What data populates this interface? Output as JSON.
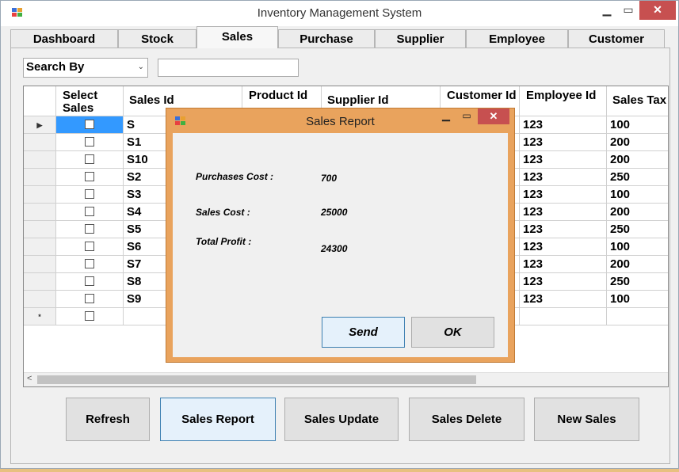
{
  "window": {
    "title": "Inventory Management System"
  },
  "tabs": [
    "Dashboard",
    "Stock",
    "Sales",
    "Purchase",
    "Supplier",
    "Employee",
    "Customer"
  ],
  "active_tab": "Sales",
  "search": {
    "selected": "Search By",
    "value": ""
  },
  "grid": {
    "headers": [
      "Select Sales",
      "Sales Id",
      "Product Id",
      "Supplier Id",
      "Customer Id",
      "Employee Id",
      "Sales Tax"
    ],
    "rows": [
      {
        "sales_id": "S",
        "employee_id": "123",
        "sales_tax": "100"
      },
      {
        "sales_id": "S1",
        "employee_id": "123",
        "sales_tax": "200"
      },
      {
        "sales_id": "S10",
        "employee_id": "123",
        "sales_tax": "200"
      },
      {
        "sales_id": "S2",
        "employee_id": "123",
        "sales_tax": "250"
      },
      {
        "sales_id": "S3",
        "employee_id": "123",
        "sales_tax": "100"
      },
      {
        "sales_id": "S4",
        "employee_id": "123",
        "sales_tax": "200"
      },
      {
        "sales_id": "S5",
        "employee_id": "123",
        "sales_tax": "250"
      },
      {
        "sales_id": "S6",
        "employee_id": "123",
        "sales_tax": "100"
      },
      {
        "sales_id": "S7",
        "employee_id": "123",
        "sales_tax": "200"
      },
      {
        "sales_id": "S8",
        "employee_id": "123",
        "sales_tax": "250"
      },
      {
        "sales_id": "S9",
        "employee_id": "123",
        "sales_tax": "100"
      }
    ],
    "current_row_marker": "▶",
    "new_row_marker": "*"
  },
  "buttons": {
    "refresh": "Refresh",
    "sales_report": "Sales Report",
    "sales_update": "Sales Update",
    "sales_delete": "Sales Delete",
    "new_sales": "New Sales"
  },
  "dialog": {
    "title": "Sales Report",
    "purchases_cost_label": "Purchases Cost :",
    "purchases_cost_value": "700",
    "sales_cost_label": "Sales Cost :",
    "sales_cost_value": "25000",
    "total_profit_label": "Total Profit :",
    "total_profit_value": "24300",
    "send_label": "Send",
    "ok_label": "OK"
  },
  "colors": {
    "dialog_frame": "#e9a35d",
    "close_button": "#c75050",
    "selected_cell": "#3399ff"
  },
  "icons": [
    "app-icon",
    "minimize-icon",
    "maximize-icon",
    "close-icon",
    "dropdown-arrow-icon",
    "row-pointer-icon",
    "scroll-left-icon"
  ]
}
